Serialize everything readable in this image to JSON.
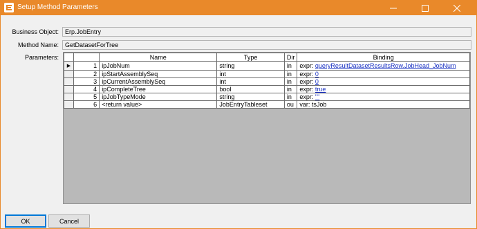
{
  "window": {
    "title": "Setup Method Parameters",
    "titlebar_color": "#e9892a",
    "icons": {
      "app": "epicor-e-icon",
      "minimize": "minimize-icon",
      "maximize": "maximize-icon",
      "close": "close-icon"
    }
  },
  "fields": {
    "business_object_label": "Business Object:",
    "business_object_value": "Erp.JobEntry",
    "method_name_label": "Method Name:",
    "method_name_value": "GetDatasetForTree",
    "parameters_label": "Parameters:"
  },
  "grid": {
    "columns": [
      "",
      "",
      "Name",
      "Type",
      "Dir",
      "Binding"
    ],
    "rows": [
      {
        "num": "1",
        "name": "ipJobNum",
        "type": "string",
        "dir": "in",
        "binding_prefix": "expr:",
        "binding_value": "queryResultDatasetResultsRow.JobHead_JobNum",
        "binding_link": true,
        "current": true
      },
      {
        "num": "2",
        "name": "ipStartAssemblySeq",
        "type": "int",
        "dir": "in",
        "binding_prefix": "expr:",
        "binding_value": "0",
        "binding_link": true,
        "current": false
      },
      {
        "num": "3",
        "name": "ipCurrentAssemblySeq",
        "type": "int",
        "dir": "in",
        "binding_prefix": "expr:",
        "binding_value": "0",
        "binding_link": true,
        "current": false
      },
      {
        "num": "4",
        "name": "ipCompleteTree",
        "type": "bool",
        "dir": "in",
        "binding_prefix": "expr:",
        "binding_value": "true",
        "binding_link": true,
        "current": false
      },
      {
        "num": "5",
        "name": "ipJobTypeMode",
        "type": "string",
        "dir": "in",
        "binding_prefix": "expr:",
        "binding_value": "\"\"",
        "binding_link": true,
        "current": false
      },
      {
        "num": "6",
        "name": "<return value>",
        "type": "JobEntryTableset",
        "dir": "ou",
        "binding_prefix": "var:",
        "binding_value": "tsJob",
        "binding_link": false,
        "current": false
      }
    ]
  },
  "buttons": {
    "ok": "OK",
    "cancel": "Cancel"
  }
}
